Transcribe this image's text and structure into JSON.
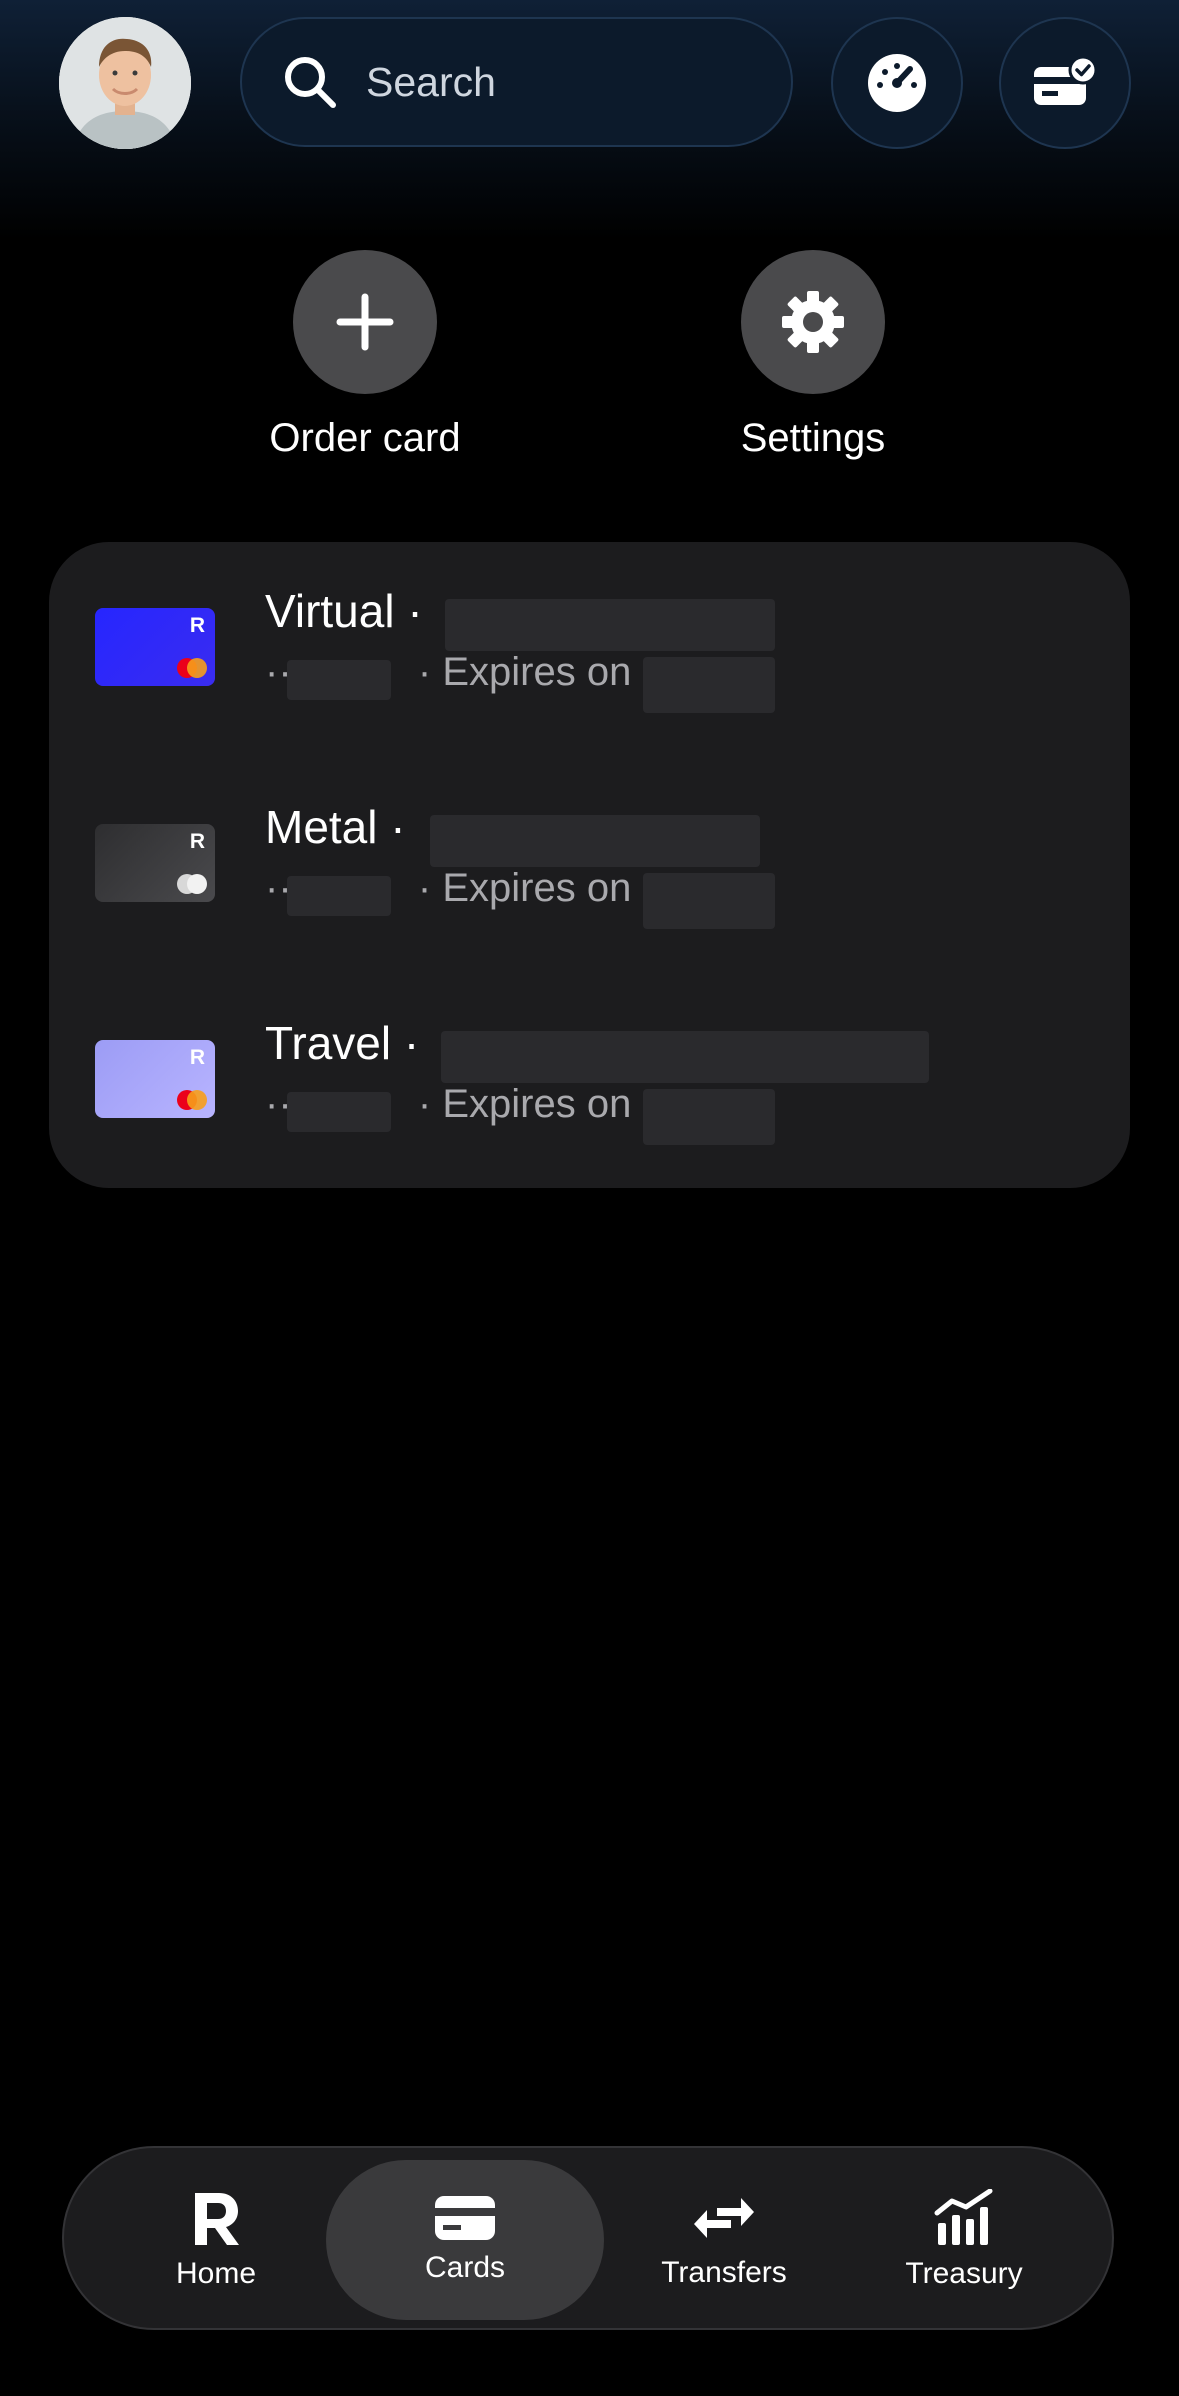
{
  "header": {
    "search_placeholder": "Search"
  },
  "actions": [
    {
      "label": "Order card",
      "icon": "plus-icon"
    },
    {
      "label": "Settings",
      "icon": "gear-icon"
    }
  ],
  "cards": [
    {
      "name": "Virtual",
      "separator": "·",
      "number_prefix": "··",
      "expires_text": "· Expires on",
      "colors": [
        "#2b2bff",
        "#3a2cf0"
      ],
      "r_color": "#ffffff"
    },
    {
      "name": "Metal",
      "separator": "·",
      "number_prefix": "··",
      "expires_text": "· Expires on",
      "colors": [
        "#2e2e30",
        "#4a4a4d"
      ],
      "r_color": "#ffffff"
    },
    {
      "name": "Travel",
      "separator": "·",
      "number_prefix": "··",
      "expires_text": "· Expires on",
      "colors": [
        "#9c9cf5",
        "#b8b4ff"
      ],
      "r_color": "#ffffff"
    }
  ],
  "nav": [
    {
      "label": "Home",
      "icon": "revolut-r-icon",
      "active": false
    },
    {
      "label": "Cards",
      "icon": "card-icon",
      "active": true
    },
    {
      "label": "Transfers",
      "icon": "transfer-arrows-icon",
      "active": false
    },
    {
      "label": "Treasury",
      "icon": "chart-bars-icon",
      "active": false
    }
  ],
  "colors": {
    "background": "#000000",
    "panel": "#1c1c1e",
    "action_circle": "#4a4a4c",
    "secondary_text": "#a9a9ad",
    "mastercard_red": "#eb001b",
    "mastercard_orange": "#f79e1b"
  }
}
